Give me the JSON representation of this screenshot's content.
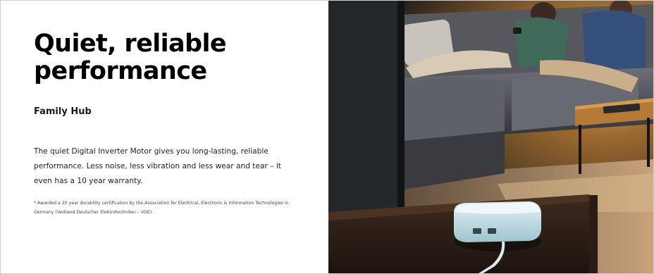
{
  "hero": {
    "headline": "Quiet, reliable performance",
    "subtitle": "Family Hub",
    "description": "The quiet Digital Inverter Motor gives you long-lasting, reliable performance. Less noise, less vibration and less wear and tear – it even has a 10 year warranty.",
    "footnote": "* Awarded a 20 year durability certification by the Association for Electrical, Electronic & Information Technologies in Germany (Verband Deutscher Elektrotechniker – VDE)."
  },
  "colors": {
    "background": "#ffffff",
    "headline": "#000000",
    "body_text": "#222222",
    "photo_warm_light": "#c8883a",
    "sofa_grey": "#4a4c52",
    "hub_device": "#c9e2ea"
  },
  "photo": {
    "subject": "living-room-with-smart-hub",
    "icons": [
      "sofa-icon",
      "couple-icon",
      "tv-panel-icon",
      "smart-hub-device-icon",
      "side-table-icon",
      "rug-icon"
    ]
  }
}
